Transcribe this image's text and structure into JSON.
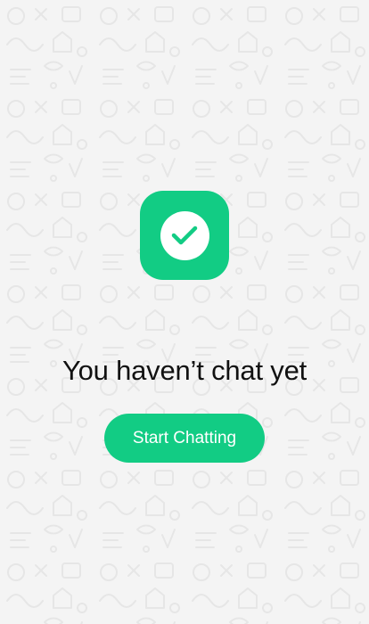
{
  "colors": {
    "accent": "#12CC84",
    "background": "#F4F4F4",
    "title_text": "#111111",
    "button_text": "#FFFFFF"
  },
  "icon": {
    "name": "check-circle-icon"
  },
  "empty_state": {
    "title": "You haven’t chat yet",
    "button_label": "Start Chatting"
  }
}
